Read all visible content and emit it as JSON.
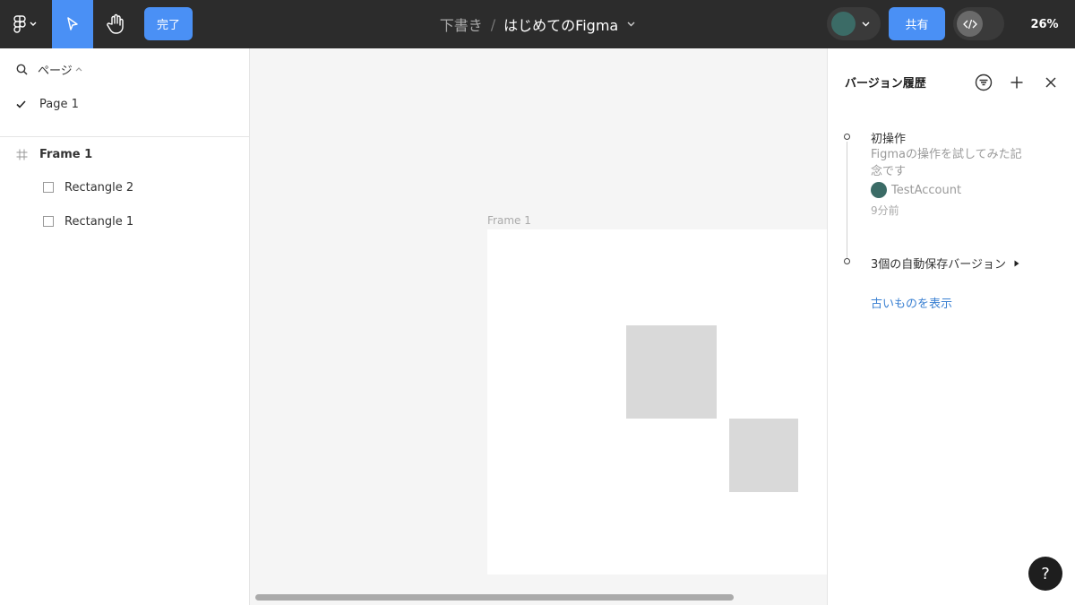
{
  "toolbar": {
    "done_label": "完了",
    "breadcrumb": {
      "folder": "下書き",
      "separator": "/",
      "file": "はじめてのFigma"
    },
    "share_label": "共有",
    "zoom": "26%",
    "icons": {
      "menu": "figma-logo-icon",
      "move": "move-cursor-icon",
      "hand": "hand-icon",
      "dev_mode": "code-icon"
    }
  },
  "left_panel": {
    "pages_label": "ページ",
    "pages": [
      {
        "label": "Page 1",
        "selected": true
      }
    ],
    "layers": [
      {
        "type": "frame",
        "label": "Frame 1"
      },
      {
        "type": "rectangle",
        "label": "Rectangle 2"
      },
      {
        "type": "rectangle",
        "label": "Rectangle 1"
      }
    ]
  },
  "canvas": {
    "frame_label": "Frame 1"
  },
  "version_history": {
    "title": "バージョン履歴",
    "versions": [
      {
        "title": "初操作",
        "description": "Figmaの操作を試してみた記念です",
        "author": "TestAccount",
        "time": "9分前"
      }
    ],
    "autosave_label": "3個の自動保存バージョン",
    "show_older_label": "古いものを表示"
  },
  "help_label": "?",
  "colors": {
    "toolbar_bg": "#2c2c2c",
    "accent": "#4a90f5",
    "avatar": "#3b6b66",
    "link": "#3a80d2"
  }
}
